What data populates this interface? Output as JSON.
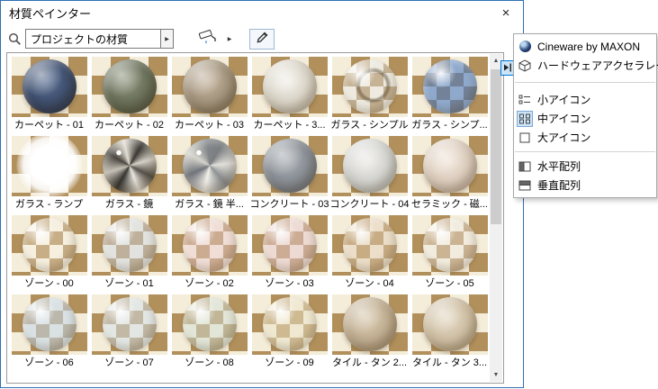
{
  "window": {
    "title": "材質ペインター",
    "close_glyph": "×"
  },
  "toolbar": {
    "search_value": "プロジェクトの材質",
    "search_dropdown_glyph": "▶",
    "paint_dropdown_glyph": "▶"
  },
  "colors": {
    "checker_dark": "#b2905c",
    "checker_light": "#f4edda",
    "accent": "#0078d7"
  },
  "scrollbar": {
    "up_glyph": "▲",
    "down_glyph": "▼"
  },
  "materials": [
    {
      "label": "カーペット - 01",
      "kind": "solid",
      "c1": "#5a6f94",
      "c2": "#2c3a55"
    },
    {
      "label": "カーペット - 02",
      "kind": "solid",
      "c1": "#8a9078",
      "c2": "#565d48"
    },
    {
      "label": "カーペット - 03",
      "kind": "solid",
      "c1": "#c4b49e",
      "c2": "#8f8069"
    },
    {
      "label": "カーペット - 3...",
      "kind": "solid",
      "c1": "#f2efe8",
      "c2": "#c9c2b2"
    },
    {
      "label": "ガラス - シンプル",
      "kind": "glass",
      "tint": "rgba(228,230,232,0.40)",
      "mark": true
    },
    {
      "label": "ガラス - シンプ...",
      "kind": "glass",
      "tint": "rgba(70,120,195,0.58)",
      "mark": false
    },
    {
      "label": "ガラス - ランプ",
      "kind": "glow"
    },
    {
      "label": "ガラス - 鏡",
      "kind": "mirror"
    },
    {
      "label": "ガラス - 鏡 半...",
      "kind": "mirror2"
    },
    {
      "label": "コンクリート - 03",
      "kind": "solid",
      "c1": "#a8adb2",
      "c2": "#757b83"
    },
    {
      "label": "コンクリート - 04",
      "kind": "solid",
      "c1": "#eceae6",
      "c2": "#c2c4c0"
    },
    {
      "label": "セラミック - 磁...",
      "kind": "solid",
      "c1": "#f2e6da",
      "c2": "#cdbcab"
    },
    {
      "label": "ゾーン - 00",
      "kind": "zone",
      "tint": "rgba(250,245,235,0.30)"
    },
    {
      "label": "ゾーン - 01",
      "kind": "zone",
      "tint": "rgba(205,215,230,0.45)"
    },
    {
      "label": "ゾーン - 02",
      "kind": "zone",
      "tint": "rgba(235,205,210,0.45)"
    },
    {
      "label": "ゾーン - 03",
      "kind": "zone",
      "tint": "rgba(230,200,205,0.50)"
    },
    {
      "label": "ゾーン - 04",
      "kind": "zone",
      "tint": "rgba(225,205,180,0.45)"
    },
    {
      "label": "ゾーン - 05",
      "kind": "zone",
      "tint": "rgba(240,235,230,0.40)"
    },
    {
      "label": "ゾーン - 06",
      "kind": "zone",
      "tint": "rgba(195,215,235,0.55)"
    },
    {
      "label": "ゾーン - 07",
      "kind": "zone",
      "tint": "rgba(210,225,238,0.50)"
    },
    {
      "label": "ゾーン - 08",
      "kind": "zone",
      "tint": "rgba(208,222,212,0.50)"
    },
    {
      "label": "ゾーン - 09",
      "kind": "zone",
      "tint": "rgba(235,228,200,0.50)"
    },
    {
      "label": "タイル - タン 2...",
      "kind": "solid",
      "c1": "#d8c9ae",
      "c2": "#b09c7e"
    },
    {
      "label": "タイル - タン 3...",
      "kind": "solid",
      "c1": "#e4d8c2",
      "c2": "#c0ae90"
    }
  ],
  "menu": {
    "items": [
      {
        "label": "Cineware by MAXON"
      },
      {
        "label": "ハードウェアアクセラレーション"
      },
      {
        "label": "小アイコン"
      },
      {
        "label": "中アイコン",
        "selected": true
      },
      {
        "label": "大アイコン"
      },
      {
        "label": "水平配列"
      },
      {
        "label": "垂直配列"
      }
    ]
  }
}
